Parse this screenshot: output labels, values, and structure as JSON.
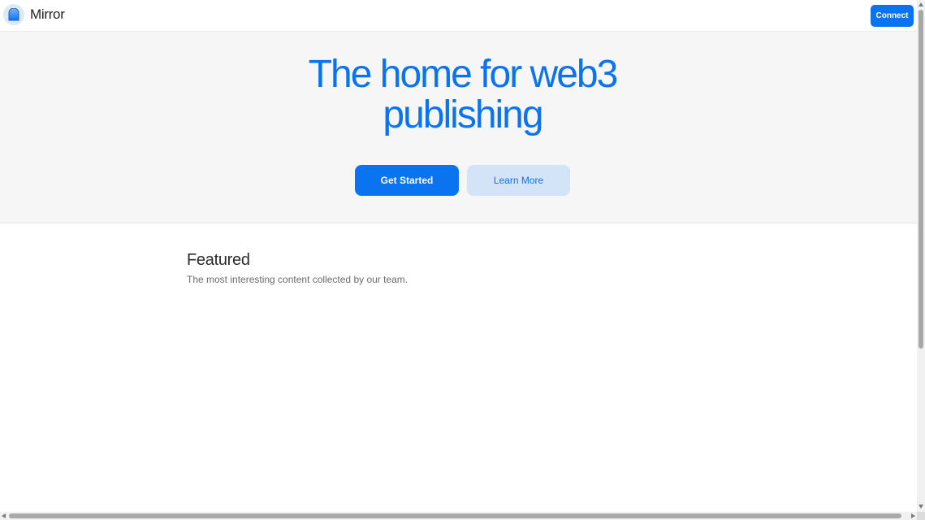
{
  "header": {
    "brand": "Mirror",
    "logo_icon": "mirror-logo-icon",
    "connect_label": "Connect"
  },
  "hero": {
    "title_line1": "The home for web3",
    "title_line2": "publishing",
    "primary_label": "Get Started",
    "secondary_label": "Learn More"
  },
  "featured": {
    "title": "Featured",
    "subtitle": "The most interesting content collected by our team."
  },
  "colors": {
    "accent": "#0a73f0",
    "accent_light": "#d3e4f8",
    "hero_bg": "#f6f6f6"
  }
}
